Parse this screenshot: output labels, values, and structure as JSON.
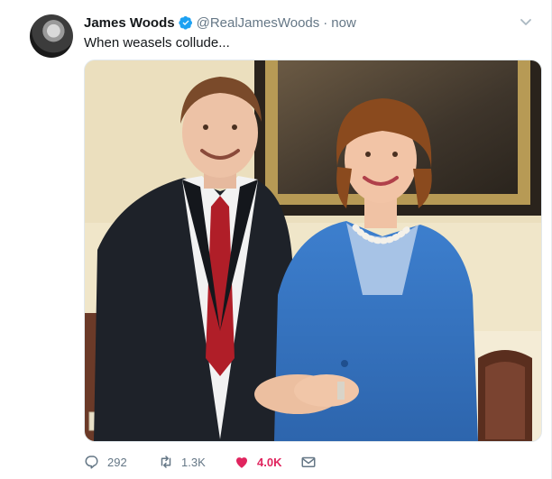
{
  "tweet": {
    "author_name": "James Woods",
    "handle": "@RealJamesWoods",
    "separator": "·",
    "time": "now",
    "text": "When weasels collude...",
    "avatar_icon": "profile-photo",
    "verified_icon": "verified-badge-icon",
    "photo_description_icon": "tweet-photo"
  },
  "actions": {
    "reply_count": "292",
    "retweet_count": "1.3K",
    "like_count": "4.0K",
    "like_active": true
  },
  "colors": {
    "accent": "#1da1f2",
    "like": "#e0245e",
    "muted": "#657786",
    "text": "#14171a"
  }
}
